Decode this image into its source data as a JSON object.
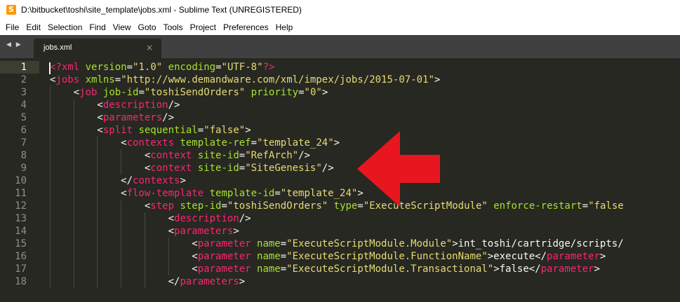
{
  "window": {
    "title": "D:\\bitbucket\\toshi\\site_template\\jobs.xml - Sublime Text (UNREGISTERED)"
  },
  "menu": [
    "File",
    "Edit",
    "Selection",
    "Find",
    "View",
    "Goto",
    "Tools",
    "Project",
    "Preferences",
    "Help"
  ],
  "tabs": [
    {
      "label": "jobs.xml",
      "close": "×"
    }
  ],
  "nav": {
    "arrows": "◀ ▶"
  },
  "colors": {
    "background": "#272822",
    "tag": "#f92672",
    "attr": "#a6e22e",
    "string": "#e6db74",
    "arrow": "#e8161f"
  },
  "editor": {
    "lines": [
      {
        "num": "1",
        "tokens": [
          [
            "t",
            "<?"
          ],
          [
            "t",
            "xml"
          ],
          [
            "p",
            " "
          ],
          [
            "a",
            "version"
          ],
          [
            "p",
            "="
          ],
          [
            "s",
            "\"1.0\""
          ],
          [
            "p",
            " "
          ],
          [
            "a",
            "encoding"
          ],
          [
            "p",
            "="
          ],
          [
            "s",
            "\"UTF-8\""
          ],
          [
            "t",
            "?>"
          ]
        ]
      },
      {
        "num": "2",
        "tokens": [
          [
            "p",
            "<"
          ],
          [
            "t",
            "jobs"
          ],
          [
            "p",
            " "
          ],
          [
            "a",
            "xmlns"
          ],
          [
            "p",
            "="
          ],
          [
            "s",
            "\"http://www.demandware.com/xml/impex/jobs/2015-07-01\""
          ],
          [
            "p",
            ">"
          ]
        ]
      },
      {
        "num": "3",
        "tokens": [
          [
            "p",
            "    <"
          ],
          [
            "t",
            "job"
          ],
          [
            "p",
            " "
          ],
          [
            "a",
            "job-id"
          ],
          [
            "p",
            "="
          ],
          [
            "s",
            "\"toshiSendOrders\""
          ],
          [
            "p",
            " "
          ],
          [
            "a",
            "priority"
          ],
          [
            "p",
            "="
          ],
          [
            "s",
            "\"0\""
          ],
          [
            "p",
            ">"
          ]
        ]
      },
      {
        "num": "4",
        "tokens": [
          [
            "p",
            "        <"
          ],
          [
            "t",
            "description"
          ],
          [
            "p",
            "/>"
          ]
        ]
      },
      {
        "num": "5",
        "tokens": [
          [
            "p",
            "        <"
          ],
          [
            "t",
            "parameters"
          ],
          [
            "p",
            "/>"
          ]
        ]
      },
      {
        "num": "6",
        "tokens": [
          [
            "p",
            "        <"
          ],
          [
            "t",
            "split"
          ],
          [
            "p",
            " "
          ],
          [
            "a",
            "sequential"
          ],
          [
            "p",
            "="
          ],
          [
            "s",
            "\"false\""
          ],
          [
            "p",
            ">"
          ]
        ]
      },
      {
        "num": "7",
        "tokens": [
          [
            "p",
            "            <"
          ],
          [
            "t",
            "contexts"
          ],
          [
            "p",
            " "
          ],
          [
            "a",
            "template-ref"
          ],
          [
            "p",
            "="
          ],
          [
            "s",
            "\"template_24\""
          ],
          [
            "p",
            ">"
          ]
        ]
      },
      {
        "num": "8",
        "tokens": [
          [
            "p",
            "                <"
          ],
          [
            "t",
            "context"
          ],
          [
            "p",
            " "
          ],
          [
            "a",
            "site-id"
          ],
          [
            "p",
            "="
          ],
          [
            "s",
            "\"RefArch\""
          ],
          [
            "p",
            "/>"
          ]
        ]
      },
      {
        "num": "9",
        "tokens": [
          [
            "p",
            "                <"
          ],
          [
            "t",
            "context"
          ],
          [
            "p",
            " "
          ],
          [
            "a",
            "site-id"
          ],
          [
            "p",
            "="
          ],
          [
            "s",
            "\"SiteGenesis\""
          ],
          [
            "p",
            "/>"
          ]
        ]
      },
      {
        "num": "10",
        "tokens": [
          [
            "p",
            "            </"
          ],
          [
            "t",
            "contexts"
          ],
          [
            "p",
            ">"
          ]
        ]
      },
      {
        "num": "11",
        "tokens": [
          [
            "p",
            "            <"
          ],
          [
            "t",
            "flow-template"
          ],
          [
            "p",
            " "
          ],
          [
            "a",
            "template-id"
          ],
          [
            "p",
            "="
          ],
          [
            "s",
            "\"template_24\""
          ],
          [
            "p",
            ">"
          ]
        ]
      },
      {
        "num": "12",
        "tokens": [
          [
            "p",
            "                <"
          ],
          [
            "t",
            "step"
          ],
          [
            "p",
            " "
          ],
          [
            "a",
            "step-id"
          ],
          [
            "p",
            "="
          ],
          [
            "s",
            "\"toshiSendOrders\""
          ],
          [
            "p",
            " "
          ],
          [
            "a",
            "type"
          ],
          [
            "p",
            "="
          ],
          [
            "s",
            "\"ExecuteScriptModule\""
          ],
          [
            "p",
            " "
          ],
          [
            "a",
            "enforce-restart"
          ],
          [
            "p",
            "="
          ],
          [
            "s",
            "\"false"
          ]
        ]
      },
      {
        "num": "13",
        "tokens": [
          [
            "p",
            "                    <"
          ],
          [
            "t",
            "description"
          ],
          [
            "p",
            "/>"
          ]
        ]
      },
      {
        "num": "14",
        "tokens": [
          [
            "p",
            "                    <"
          ],
          [
            "t",
            "parameters"
          ],
          [
            "p",
            ">"
          ]
        ]
      },
      {
        "num": "15",
        "tokens": [
          [
            "p",
            "                        <"
          ],
          [
            "t",
            "parameter"
          ],
          [
            "p",
            " "
          ],
          [
            "a",
            "name"
          ],
          [
            "p",
            "="
          ],
          [
            "s",
            "\"ExecuteScriptModule.Module\""
          ],
          [
            "p",
            ">int_toshi/cartridge/scripts/"
          ]
        ]
      },
      {
        "num": "16",
        "tokens": [
          [
            "p",
            "                        <"
          ],
          [
            "t",
            "parameter"
          ],
          [
            "p",
            " "
          ],
          [
            "a",
            "name"
          ],
          [
            "p",
            "="
          ],
          [
            "s",
            "\"ExecuteScriptModule.FunctionName\""
          ],
          [
            "p",
            ">execute</"
          ],
          [
            "t",
            "parameter"
          ],
          [
            "p",
            ">"
          ]
        ]
      },
      {
        "num": "17",
        "tokens": [
          [
            "p",
            "                        <"
          ],
          [
            "t",
            "parameter"
          ],
          [
            "p",
            " "
          ],
          [
            "a",
            "name"
          ],
          [
            "p",
            "="
          ],
          [
            "s",
            "\"ExecuteScriptModule.Transactional\""
          ],
          [
            "p",
            ">false</"
          ],
          [
            "t",
            "parameter"
          ],
          [
            "p",
            ">"
          ]
        ]
      },
      {
        "num": "18",
        "tokens": [
          [
            "p",
            "                    </"
          ],
          [
            "t",
            "parameters"
          ],
          [
            "p",
            ">"
          ]
        ]
      }
    ]
  }
}
